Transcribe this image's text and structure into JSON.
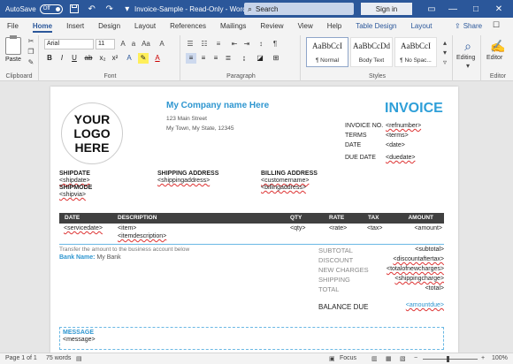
{
  "titlebar": {
    "autosave_label": "AutoSave",
    "autosave_state": "Off",
    "doc_title": "Invoice-Sample - Read-Only - Word",
    "search_placeholder": "Search",
    "signin_label": "Sign in",
    "minimize": "—",
    "maximize": "□",
    "close": "✕",
    "accent": "#2b579a"
  },
  "tabs": [
    {
      "label": "File"
    },
    {
      "label": "Home",
      "active": true
    },
    {
      "label": "Insert"
    },
    {
      "label": "Design"
    },
    {
      "label": "Layout"
    },
    {
      "label": "References"
    },
    {
      "label": "Mailings"
    },
    {
      "label": "Review"
    },
    {
      "label": "View"
    },
    {
      "label": "Help"
    },
    {
      "label": "Table Design",
      "context": true
    },
    {
      "label": "Layout",
      "context": true
    }
  ],
  "share_label": "Share",
  "ribbon": {
    "clipboard": {
      "paste_label": "Paste",
      "group_label": "Clipboard"
    },
    "font": {
      "font_name": "Arial",
      "font_size": "11",
      "group_label": "Font"
    },
    "paragraph": {
      "group_label": "Paragraph"
    },
    "styles": {
      "group_label": "Styles",
      "tiles": [
        {
          "sample": "AaBbCcI",
          "name": "¶ Normal"
        },
        {
          "sample": "AaBbCcDd",
          "name": "Body Text"
        },
        {
          "sample": "AaBbCcI",
          "name": "¶ No Spac..."
        }
      ]
    },
    "editing": {
      "label": "Editing"
    },
    "editor": {
      "label": "Editor",
      "group_label": "Editor"
    }
  },
  "invoice": {
    "logo_lines": [
      "YOUR",
      "LOGO",
      "HERE"
    ],
    "company_name": "My Company name Here",
    "address_line1": "123 Main Street",
    "address_line2": "My Town, My State, 12345",
    "title": "INVOICE",
    "fields": [
      {
        "label": "INVOICE NO.",
        "value": "<refnumber>",
        "flag": true
      },
      {
        "label": "TERMS",
        "value": "<terms>",
        "flag": false
      },
      {
        "label": "DATE",
        "value": "<date>",
        "flag": false
      },
      {
        "label": "DUE DATE",
        "value": "<duedate>",
        "flag": true
      }
    ],
    "shipdate_label": "SHIPDATE",
    "shipdate_value": "<shipdate>",
    "shipmode_label": "SHIPMODE",
    "shipmode_value": "<shipvia>",
    "shipping_address_label": "SHIPPING ADDRESS",
    "shipping_address_value": "<shippingaddress>",
    "billing_address_label": "BILLING ADDRESS",
    "billing_customer": "<customername>",
    "billing_address_value": "<billingaddress>",
    "table_headers": [
      "DATE",
      "DESCRIPTION",
      "QTY",
      "RATE",
      "TAX",
      "AMOUNT"
    ],
    "row": {
      "date": "<servicedate>",
      "item": "<item>",
      "description": "<itemdescription>",
      "qty": "<qty>",
      "rate": "<rate>",
      "tax": "<tax>",
      "amount": "<amount>"
    },
    "transfer_text": "Transfer the amount to the business account below",
    "bank_label": "Bank Name:",
    "bank_value": "My Bank",
    "summary": [
      {
        "label": "SUBTOTAL",
        "value": "<subtotal>",
        "flag": false
      },
      {
        "label": "DISCOUNT",
        "value": "<discountaftertax>",
        "flag": true
      },
      {
        "label": "NEW CHARGES",
        "value": "<totalofnewcharges>",
        "flag": true
      },
      {
        "label": "SHIPPING",
        "value": "<shippingcharge>",
        "flag": true
      },
      {
        "label": "TOTAL",
        "value": "<total>",
        "flag": false
      }
    ],
    "balance_label": "BALANCE DUE",
    "balance_value": "<amountdue>",
    "message_label": "MESSAGE",
    "message_value": "<message>"
  },
  "statusbar": {
    "page": "Page 1 of 1",
    "words": "75 words",
    "focus": "Focus",
    "zoom": "100%",
    "zoom_minus": "−",
    "zoom_plus": "+"
  }
}
